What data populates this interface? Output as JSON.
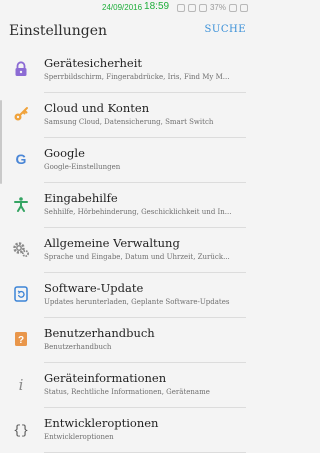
{
  "status_bar": {
    "date": "24/09/2016",
    "time": "18:59",
    "battery": "37%"
  },
  "app_bar": {
    "title": "Einstellungen",
    "search_label": "SUCHE"
  },
  "settings": [
    {
      "title": "Gerätesicherheit",
      "subtitle": "Sperrbildschirm, Fingerabdrücke, Iris, Find My M...",
      "icon": "lock-icon",
      "color": "#8c6bd4"
    },
    {
      "title": "Cloud und Konten",
      "subtitle": "Samsung Cloud, Datensicherung, Smart Switch",
      "icon": "key-icon",
      "color": "#f0a23a"
    },
    {
      "title": "Google",
      "subtitle": "Google-Einstellungen",
      "icon": "google-icon",
      "color": "#4a86d6"
    },
    {
      "title": "Eingabehilfe",
      "subtitle": "Sehhilfe, Hörbehinderung, Geschicklichkeit und In...",
      "icon": "accessibility-icon",
      "color": "#35a463"
    },
    {
      "title": "Allgemeine Verwaltung",
      "subtitle": "Sprache und Eingabe, Datum und Uhrzeit, Zurück...",
      "icon": "gear-icon",
      "color": "#8a8a8a"
    },
    {
      "title": "Software-Update",
      "subtitle": "Updates herunterladen, Geplante Software-Updates",
      "icon": "software-update-icon",
      "color": "#3b83d6"
    },
    {
      "title": "Benutzerhandbuch",
      "subtitle": "Benutzerhandbuch",
      "icon": "user-manual-icon",
      "color": "#e9964a"
    },
    {
      "title": "Geräteinformationen",
      "subtitle": "Status, Rechtliche Informationen, Gerätename",
      "icon": "info-icon",
      "color": "#8a8a8a"
    },
    {
      "title": "Entwickleroptionen",
      "subtitle": "Entwickleroptionen",
      "icon": "developer-braces-icon",
      "color": "#555555"
    }
  ]
}
